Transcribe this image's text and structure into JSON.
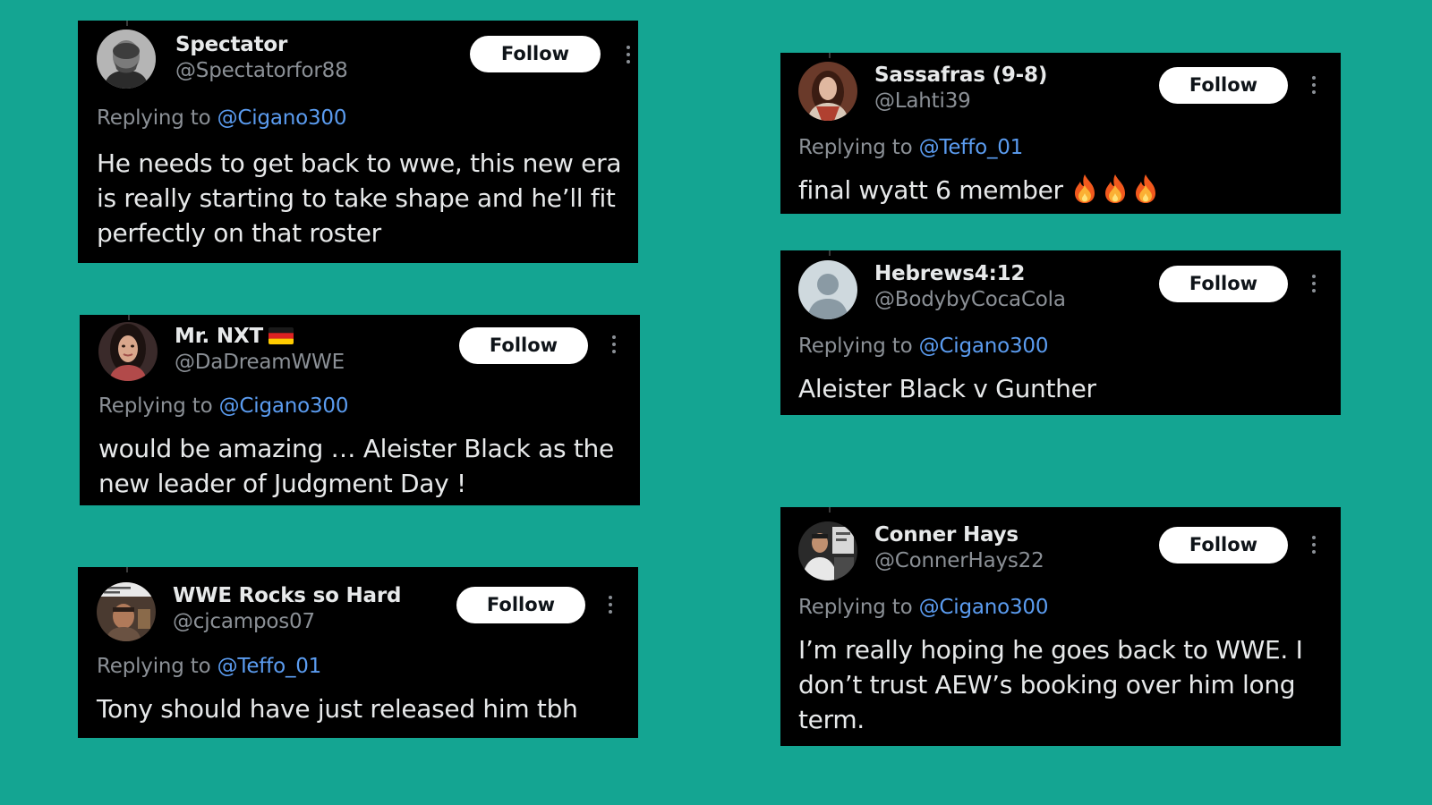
{
  "tweets": [
    {
      "name": "Spectator",
      "handle": "@Spectatorfor88",
      "follow_label": "Follow",
      "replying_prefix": "Replying to",
      "replying_to": "@Cigano300",
      "text": "He needs to get back to wwe, this new era is really starting to take shape and he’ll fit perfectly on that roster"
    },
    {
      "name": "Mr. NXT",
      "handle": "@DaDreamWWE",
      "follow_label": "Follow",
      "replying_prefix": "Replying to",
      "replying_to": "@Cigano300",
      "text": "would be amazing … Aleister Black as the new leader of Judgment Day !"
    },
    {
      "name": "WWE Rocks so Hard",
      "handle": "@cjcampos07",
      "follow_label": "Follow",
      "replying_prefix": "Replying to",
      "replying_to": "@Teffo_01",
      "text": "Tony should have just released him tbh"
    },
    {
      "name": "Sassafras (9-8)",
      "handle": "@Lahti39",
      "follow_label": "Follow",
      "replying_prefix": "Replying to",
      "replying_to": "@Teffo_01",
      "text": "final wyatt 6 member"
    },
    {
      "name": "Hebrews4:12",
      "handle": "@BodybyCocaCola",
      "follow_label": "Follow",
      "replying_prefix": "Replying to",
      "replying_to": "@Cigano300",
      "text": "Aleister Black v Gunther"
    },
    {
      "name": "Conner Hays",
      "handle": "@ConnerHays22",
      "follow_label": "Follow",
      "replying_prefix": "Replying to",
      "replying_to": "@Cigano300",
      "text": "I’m really hoping he goes back to WWE. I don’t trust AEW’s booking over him long term."
    }
  ],
  "icons": {
    "flag": "germany-flag-icon",
    "fire": "fire-emoji-icon",
    "more": "more-options-icon",
    "default_avatar": "default-avatar-icon"
  },
  "colors": {
    "background": "#14a592",
    "card": "#000000",
    "mention": "#5b9cf0",
    "secondary_text": "#8b9096",
    "follow_button": "#ffffff"
  }
}
